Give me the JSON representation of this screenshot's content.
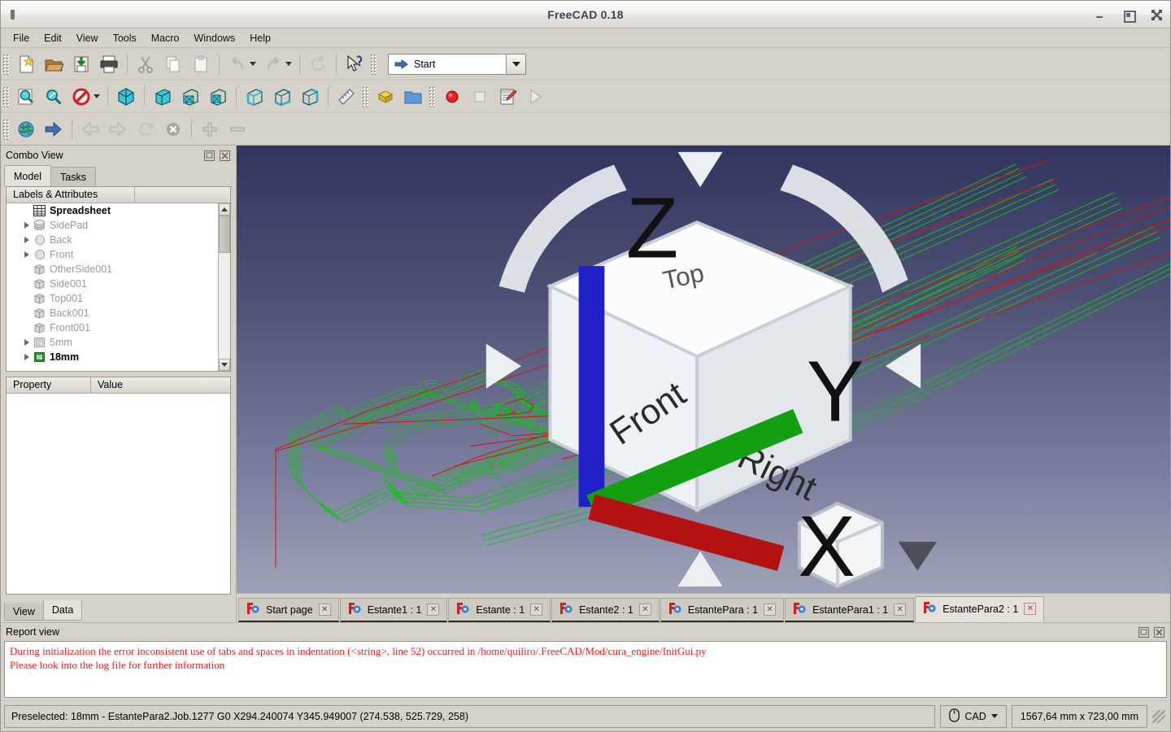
{
  "window": {
    "title": "FreeCAD 0.18",
    "minimize_label": "Minimize",
    "maximize_label": "Maximize",
    "close_label": "Close"
  },
  "menubar": {
    "items": [
      {
        "label": "File"
      },
      {
        "label": "Edit"
      },
      {
        "label": "View"
      },
      {
        "label": "Tools"
      },
      {
        "label": "Macro"
      },
      {
        "label": "Windows"
      },
      {
        "label": "Help"
      }
    ]
  },
  "toolbar_file": {
    "buttons": [
      {
        "name": "new-document",
        "icon": "new-file-icon"
      },
      {
        "name": "open-document",
        "icon": "open-folder-icon"
      },
      {
        "name": "save-document",
        "icon": "save-icon"
      },
      {
        "name": "print-document",
        "icon": "print-icon"
      },
      {
        "name": "cut",
        "icon": "scissors-icon"
      },
      {
        "name": "copy",
        "icon": "copy-icon"
      },
      {
        "name": "paste",
        "icon": "clipboard-icon"
      },
      {
        "name": "undo",
        "icon": "undo-icon"
      },
      {
        "name": "redo",
        "icon": "redo-icon"
      },
      {
        "name": "refresh",
        "icon": "refresh-icon"
      },
      {
        "name": "whats-this",
        "icon": "whats-this-icon"
      }
    ]
  },
  "workbench": {
    "selected": "Start",
    "options": [
      "Start"
    ]
  },
  "toolbar_view": {
    "buttons": [
      {
        "name": "fit-all",
        "icon": "fit-all-icon"
      },
      {
        "name": "fit-selection",
        "icon": "zoom-selection-icon"
      },
      {
        "name": "draw-style",
        "icon": "draw-style-icon"
      },
      {
        "name": "isometric-view",
        "icon": "axonometric-icon"
      },
      {
        "name": "front-view",
        "icon": "front-view-icon"
      },
      {
        "name": "top-view",
        "icon": "top-view-icon"
      },
      {
        "name": "right-view",
        "icon": "right-view-icon"
      },
      {
        "name": "rear-view",
        "icon": "rear-view-icon"
      },
      {
        "name": "bottom-view",
        "icon": "bottom-view-icon"
      },
      {
        "name": "left-view",
        "icon": "left-view-icon"
      },
      {
        "name": "measure",
        "icon": "ruler-icon"
      },
      {
        "name": "workbench-default",
        "icon": "yellow-blocks-icon"
      },
      {
        "name": "open-folder",
        "icon": "blue-folder-icon"
      },
      {
        "name": "macro-record",
        "icon": "record-circle-icon"
      },
      {
        "name": "macro-stop",
        "icon": "stop-square-icon"
      },
      {
        "name": "macro-edit",
        "icon": "macro-editor-icon"
      },
      {
        "name": "macro-execute",
        "icon": "play-triangle-icon"
      }
    ]
  },
  "toolbar_nav": {
    "buttons": [
      {
        "name": "web-browser",
        "icon": "globe-icon"
      },
      {
        "name": "go-to-page",
        "icon": "blue-arrow-right-icon"
      },
      {
        "name": "back",
        "icon": "arrow-left-icon"
      },
      {
        "name": "forward",
        "icon": "arrow-right-icon"
      },
      {
        "name": "reload",
        "icon": "reload-icon"
      },
      {
        "name": "stop-loading",
        "icon": "stop-x-icon"
      },
      {
        "name": "zoom-in",
        "icon": "plus-icon"
      },
      {
        "name": "zoom-out",
        "icon": "minus-icon"
      }
    ]
  },
  "combo_view": {
    "title": "Combo View",
    "float_button": "float-icon",
    "close_button": "close-icon",
    "tabs": [
      {
        "label": "Model",
        "active": true
      },
      {
        "label": "Tasks",
        "active": false
      }
    ],
    "tree_header": "Labels & Attributes",
    "tree_items": [
      {
        "label": "Spreadsheet",
        "icon": "spreadsheet-icon",
        "expandable": false,
        "state": "bold"
      },
      {
        "label": "SidePad",
        "icon": "pad-icon",
        "expandable": true,
        "state": "dim"
      },
      {
        "label": "Back",
        "icon": "sphere-icon",
        "expandable": true,
        "state": "dim"
      },
      {
        "label": "Front",
        "icon": "sphere-icon",
        "expandable": true,
        "state": "dim"
      },
      {
        "label": "OtherSide001",
        "icon": "box-icon",
        "expandable": false,
        "state": "dim"
      },
      {
        "label": "Side001",
        "icon": "box-icon",
        "expandable": false,
        "state": "dim"
      },
      {
        "label": "Top001",
        "icon": "box-icon",
        "expandable": false,
        "state": "dim"
      },
      {
        "label": "Back001",
        "icon": "box-icon",
        "expandable": false,
        "state": "dim"
      },
      {
        "label": "Front001",
        "icon": "box-icon",
        "expandable": false,
        "state": "dim"
      },
      {
        "label": "5mm",
        "icon": "job-icon",
        "expandable": true,
        "state": "dim"
      },
      {
        "label": "18mm",
        "icon": "job-icon-active",
        "expandable": true,
        "state": "bold"
      }
    ],
    "property_columns": [
      "Property",
      "Value"
    ],
    "property_rows": [],
    "bottom_tabs": [
      {
        "label": "View",
        "active": false
      },
      {
        "label": "Data",
        "active": true
      }
    ]
  },
  "viewport": {
    "nav_cube": {
      "front_label": "Front",
      "right_label": "Right",
      "top_label": "Top"
    },
    "axis_labels": {
      "x": "X",
      "y": "Y",
      "z": "Z"
    },
    "origin_axis_labels": {
      "x": "X",
      "z": "Z"
    },
    "colors": {
      "toolpath_cut": "#11c211",
      "toolpath_rapid": "#d21414",
      "highlight": "#2222aa",
      "bg_top": "#32355f",
      "bg_bottom": "#9ea2b8"
    }
  },
  "document_tabs": [
    {
      "label": "Start page",
      "active": false
    },
    {
      "label": "Estante1 : 1",
      "active": false
    },
    {
      "label": "Estante : 1",
      "active": false
    },
    {
      "label": "Estante2 : 1",
      "active": false
    },
    {
      "label": "EstantePara : 1",
      "active": false
    },
    {
      "label": "EstantePara1 : 1",
      "active": false
    },
    {
      "label": "EstantePara2 : 1",
      "active": true
    }
  ],
  "report_view": {
    "title": "Report view",
    "float_button": "float-icon",
    "close_button": "close-icon",
    "lines": [
      "During initialization the error inconsistent use of tabs and spaces in indentation (<string>, line 52) occurred in /home/quiliro/.FreeCAD/Mod/cura_engine/InitGui.py",
      "Please look into the log file for further information"
    ]
  },
  "status_bar": {
    "message": "Preselected: 18mm - EstantePara2.Job.1277 G0 X294.240074 Y345.949007 (274.538, 525.729, 258)",
    "navigation_style": "CAD",
    "dimensions": "1567,64 mm x 723,00 mm"
  }
}
